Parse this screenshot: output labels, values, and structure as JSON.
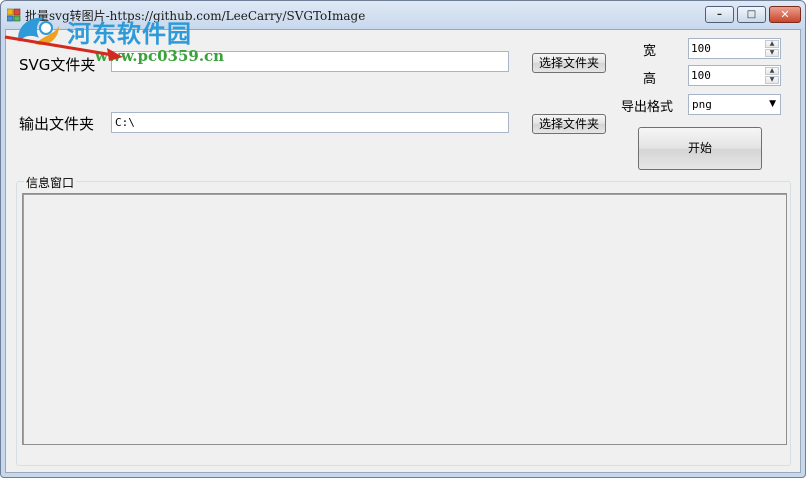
{
  "window": {
    "title": "批量svg转图片-https://github.com/LeeCarry/SVGToImage",
    "controls": {
      "minimize": "–",
      "maximize": "□",
      "close": "✕"
    }
  },
  "form": {
    "svg_folder_label": "SVG文件夹",
    "svg_folder_value": "",
    "output_folder_label": "输出文件夹",
    "output_folder_value": "C:\\",
    "browse_svg_button": "选择文件夹",
    "browse_output_button": "选择文件夹",
    "width_label": "宽",
    "width_value": "100",
    "height_label": "高",
    "height_value": "100",
    "format_label": "导出格式",
    "format_value": "png",
    "start_button": "开始",
    "info_group_title": "信息窗口"
  },
  "watermark": {
    "site_name": "河东软件园",
    "site_url": "www.pc0359.cn"
  },
  "colors": {
    "watermark_blue": "#2e9ad8",
    "watermark_green": "#3aa23a",
    "arrow_red": "#d22a1f"
  }
}
